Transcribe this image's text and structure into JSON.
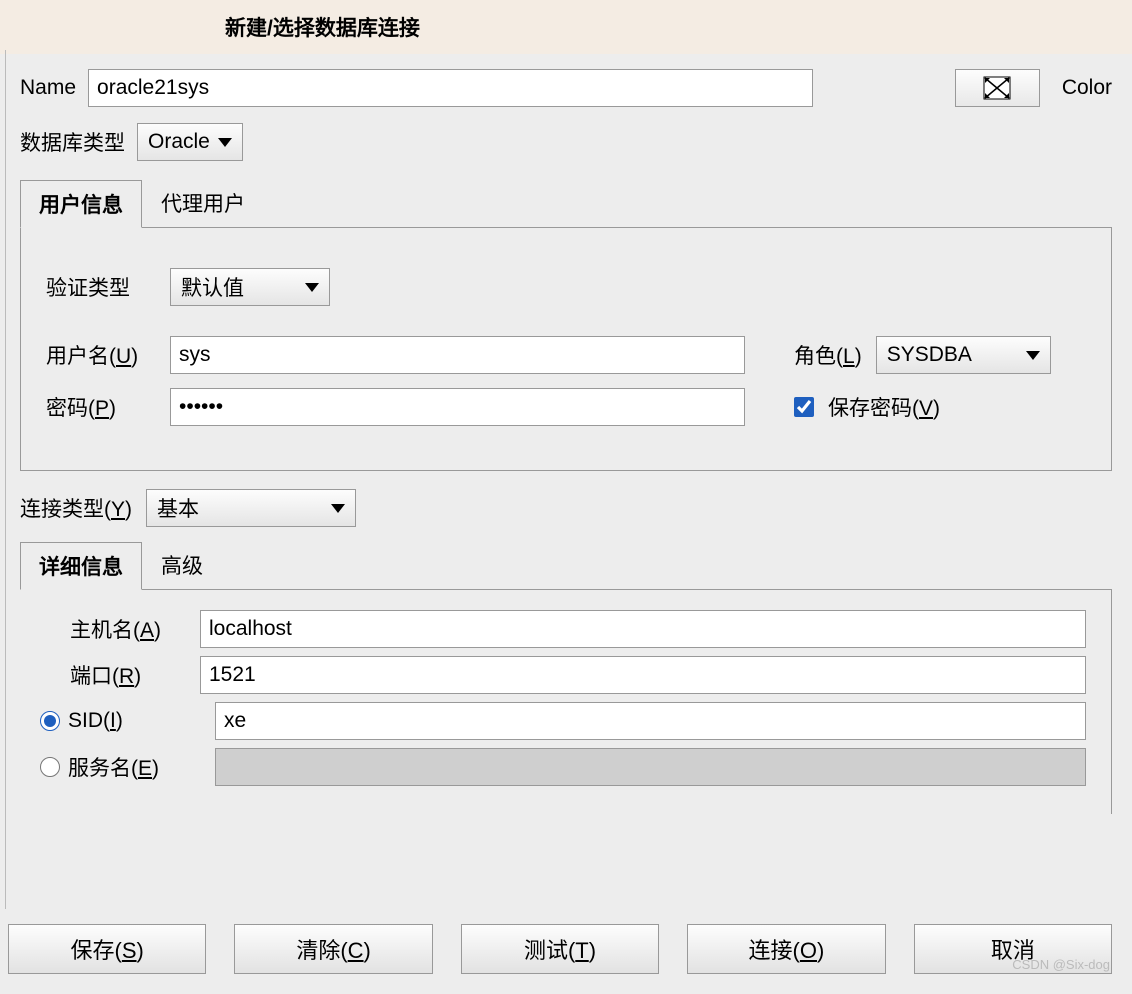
{
  "title": "新建/选择数据库连接",
  "header": {
    "name_label": "Name",
    "name_value": "oracle21sys",
    "color_label": "Color"
  },
  "db_type": {
    "label": "数据库类型",
    "value": "Oracle"
  },
  "tabs": {
    "user_info": "用户信息",
    "proxy_user": "代理用户"
  },
  "user_panel": {
    "auth_type_label": "验证类型",
    "auth_type_value": "默认值",
    "username_label_pre": "用户名(",
    "username_label_key": "U",
    "username_label_post": ")",
    "username_value": "sys",
    "role_label_pre": "角色(",
    "role_label_key": "L",
    "role_label_post": ")",
    "role_value": "SYSDBA",
    "password_label_pre": "密码(",
    "password_label_key": "P",
    "password_label_post": ")",
    "password_value": "••••••",
    "save_password_pre": "保存密码(",
    "save_password_key": "V",
    "save_password_post": ")",
    "save_password_checked": true
  },
  "connection_type": {
    "label_pre": "连接类型(",
    "label_key": "Y",
    "label_post": ")",
    "value": "基本"
  },
  "details_tabs": {
    "detail": "详细信息",
    "advanced": "高级"
  },
  "details": {
    "host_label_pre": "主机名(",
    "host_label_key": "A",
    "host_label_post": ")",
    "host_value": "localhost",
    "port_label_pre": "端口(",
    "port_label_key": "R",
    "port_label_post": ")",
    "port_value": "1521",
    "sid_label_pre": "SID(",
    "sid_label_key": "I",
    "sid_label_post": ")",
    "sid_value": "xe",
    "sid_checked": true,
    "service_label_pre": "服务名(",
    "service_label_key": "E",
    "service_label_post": ")",
    "service_value": "",
    "service_checked": false
  },
  "buttons": {
    "save_pre": "保存(",
    "save_key": "S",
    "save_post": ")",
    "clear_pre": "清除(",
    "clear_key": "C",
    "clear_post": ")",
    "test_pre": "测试(",
    "test_key": "T",
    "test_post": ")",
    "connect_pre": "连接(",
    "connect_key": "O",
    "connect_post": ")",
    "cancel": "取消"
  },
  "watermark": "CSDN @Six-dog"
}
